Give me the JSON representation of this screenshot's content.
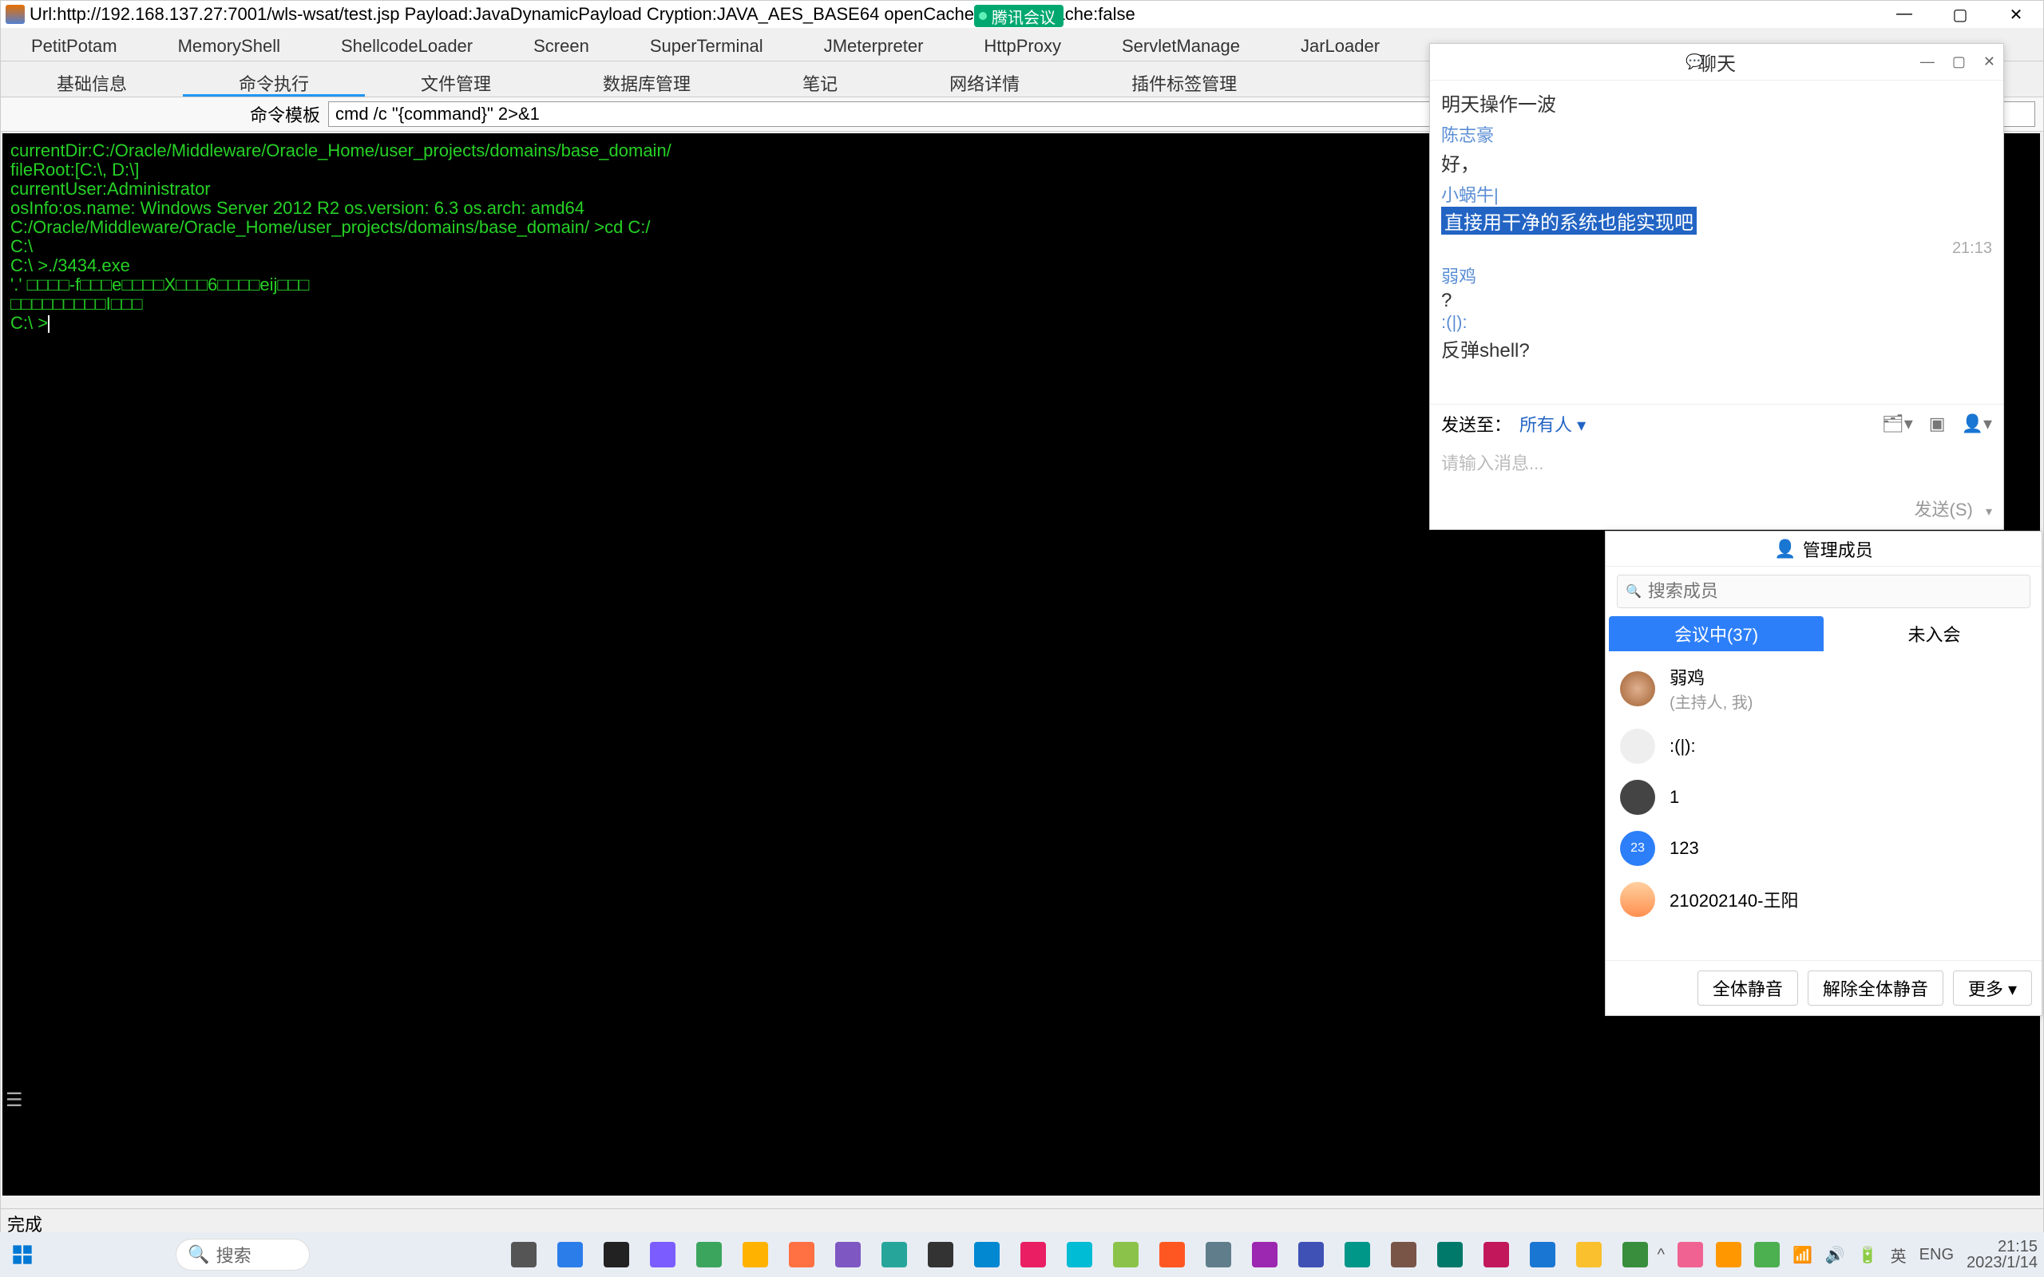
{
  "window": {
    "title": "Url:http://192.168.137.27:7001/wls-wsat/test.jsp Payload:JavaDynamicPayload Cryption:JAVA_AES_BASE64 openCache:true useCache:false",
    "min": "—",
    "max": "▢",
    "close": "✕"
  },
  "meeting_badge": "腾讯会议",
  "tabs_row1": [
    "PetitPotam",
    "MemoryShell",
    "ShellcodeLoader",
    "Screen",
    "SuperTerminal",
    "JMeterpreter",
    "HttpProxy",
    "ServletManage",
    "JarLoader"
  ],
  "tabs_row2": [
    "基础信息",
    "命令执行",
    "文件管理",
    "数据库管理",
    "笔记",
    "网络详情",
    "插件标签管理"
  ],
  "active_tab2_index": 1,
  "cmd_template": {
    "label": "命令模板",
    "value": "cmd /c \"{command}\" 2>&1"
  },
  "terminal_lines": [
    "currentDir:C:/Oracle/Middleware/Oracle_Home/user_projects/domains/base_domain/",
    "fileRoot:[C:\\, D:\\]",
    "currentUser:Administrator",
    "osInfo:os.name: Windows Server 2012 R2 os.version: 6.3 os.arch: amd64",
    "",
    "C:/Oracle/Middleware/Oracle_Home/user_projects/domains/base_domain/ >cd C:/",
    "",
    "C:\\",
    "C:\\ >./3434.exe",
    "",
    "'.' □□□□-f□□□e□□□□X□□□6□□□□eij□□□",
    "□□□□□□□□□I□□□",
    "C:\\ >"
  ],
  "statusbar": "完成",
  "chat": {
    "title": "聊天",
    "controls": [
      "—",
      "▢",
      "✕"
    ],
    "messages": [
      {
        "type": "msg",
        "text": "明天操作一波"
      },
      {
        "type": "name",
        "text": "陈志豪"
      },
      {
        "type": "msg",
        "text": "好，"
      },
      {
        "type": "name",
        "text": "小蜗牛|"
      },
      {
        "type": "highlight",
        "text": "直接用干净的系统也能实现吧"
      },
      {
        "type": "time",
        "text": "21:13"
      },
      {
        "type": "name",
        "text": "弱鸡"
      },
      {
        "type": "msg",
        "text": "?"
      },
      {
        "type": "emoji",
        "text": ":(|):"
      },
      {
        "type": "msg",
        "text": "反弹shell?"
      }
    ],
    "sendto_label": "发送至：",
    "sendto_value": "所有人 ▾",
    "input_placeholder": "请输入消息...",
    "send_btn": "发送(S)"
  },
  "members": {
    "header": "管理成员",
    "search_placeholder": "搜索成员",
    "tab_active": "会议中(37)",
    "tab_inactive": "未入会",
    "list": [
      {
        "name": "弱鸡",
        "sub": "(主持人, 我)",
        "avatar": "img1"
      },
      {
        "name": ":(|):",
        "avatar": "img2"
      },
      {
        "name": "1",
        "avatar": "img3"
      },
      {
        "name": "123",
        "avatar": "blue",
        "badge": "23"
      },
      {
        "name": "210202140-王阳",
        "avatar": "img4"
      }
    ],
    "footer": [
      "全体静音",
      "解除全体静音",
      "更多 ▾"
    ]
  },
  "taskbar": {
    "search": "搜索",
    "tray": {
      "ime": "英",
      "lang": "ENG",
      "time": "21:15",
      "date": "2023/1/14"
    }
  }
}
